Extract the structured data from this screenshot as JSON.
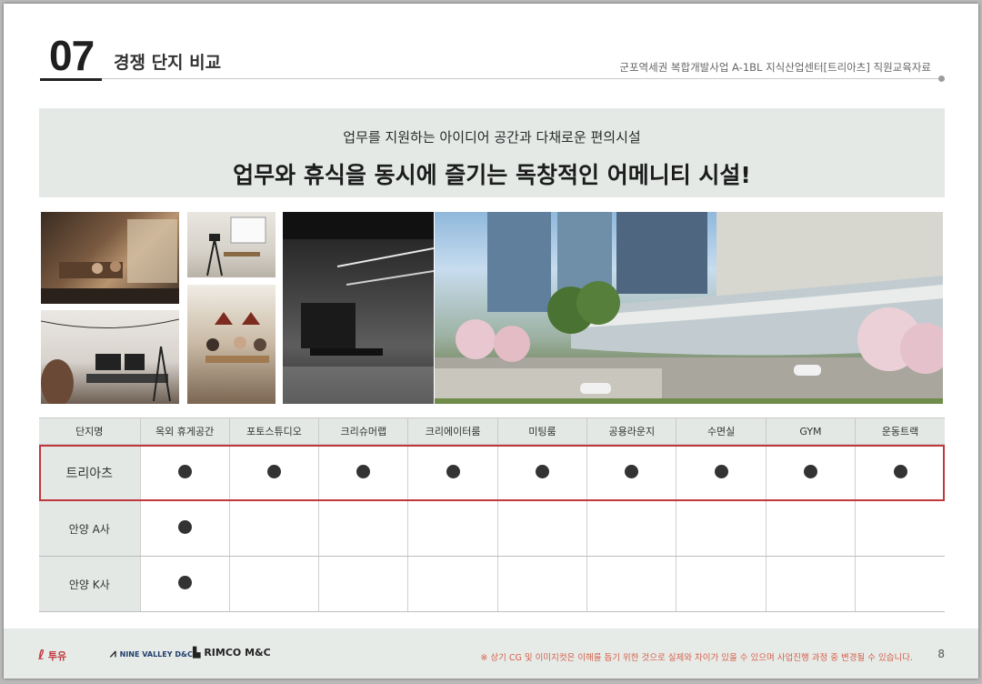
{
  "header": {
    "section_number": "07",
    "section_title": "경쟁 단지 비교",
    "document_title": "군포역세권 복합개발사업 A-1BL 지식산업센터[트리아츠] 직원교육자료"
  },
  "banner": {
    "subtitle": "업무를 지원하는 아이디어 공간과 다채로운 편의시설",
    "title": "업무와 휴식을 동시에 즐기는 독창적인 어메니티 시설!"
  },
  "table": {
    "headers": [
      "단지명",
      "옥외 휴게공간",
      "포토스튜디오",
      "크리슈머랩",
      "크리에이터룸",
      "미팅룸",
      "공용라운지",
      "수면실",
      "GYM",
      "운동트랙"
    ],
    "rows": [
      {
        "name": "트리아츠",
        "has": [
          true,
          true,
          true,
          true,
          true,
          true,
          true,
          true,
          true
        ],
        "highlight": true
      },
      {
        "name": "안양 A사",
        "has": [
          true,
          false,
          false,
          false,
          false,
          false,
          false,
          false,
          false
        ],
        "highlight": false
      },
      {
        "name": "안양 K사",
        "has": [
          true,
          false,
          false,
          false,
          false,
          false,
          false,
          false,
          false
        ],
        "highlight": false
      }
    ]
  },
  "footer": {
    "logos": [
      "투유",
      "NINE VALLEY D&C",
      "RIMCO M&C"
    ],
    "disclaimer": "※ 상기 CG 및 이미지컷은 이해를 돕기 위한 것으로 실제와 차이가 있을 수 있으며 사업진행 과정 중 변경될 수 있습니다.",
    "page_number": "8"
  },
  "colors": {
    "highlight_border": "#c0383d",
    "banner_bg": "#e4e9e6",
    "disclaimer": "#d5604a"
  }
}
